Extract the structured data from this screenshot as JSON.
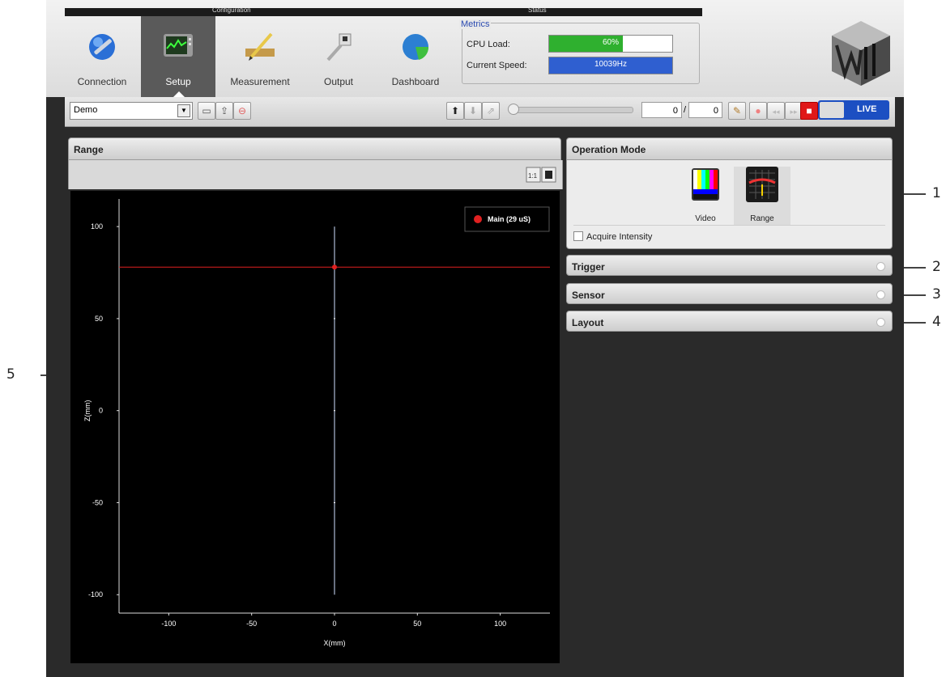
{
  "nav": {
    "group_configuration": "Configuration",
    "group_status": "Status",
    "tabs": [
      {
        "label": "Connection",
        "icon": "wrench-globe-icon"
      },
      {
        "label": "Setup",
        "icon": "monitor-graph-icon",
        "active": true
      },
      {
        "label": "Measurement",
        "icon": "ruler-pencil-icon"
      },
      {
        "label": "Output",
        "icon": "plug-cable-icon"
      },
      {
        "label": "Dashboard",
        "icon": "pie-globe-icon"
      }
    ]
  },
  "metrics": {
    "title": "Metrics",
    "cpu_label": "CPU Load:",
    "cpu_value": "60%",
    "cpu_fraction": 0.6,
    "speed_label": "Current Speed:",
    "speed_value": "10039Hz",
    "speed_fraction": 1.0,
    "cpu_color": "#2fb02f",
    "speed_color": "#2f5fd0"
  },
  "toolbar": {
    "profile": "Demo",
    "frame_current": "0",
    "frame_total": "0",
    "live_label": "LIVE",
    "live_color": "#1c4fc2",
    "stop_color": "#e01818"
  },
  "range_panel": {
    "title": "Range"
  },
  "operation_mode": {
    "title": "Operation Mode",
    "modes": [
      {
        "label": "Video",
        "icon": "color-bars-icon"
      },
      {
        "label": "Range",
        "icon": "range-grid-icon",
        "active": true
      }
    ],
    "acquire_intensity": "Acquire Intensity"
  },
  "sections": [
    {
      "label": "Trigger"
    },
    {
      "label": "Sensor"
    },
    {
      "label": "Layout"
    }
  ],
  "callouts": [
    "1",
    "2",
    "3",
    "4",
    "5"
  ],
  "chart_data": {
    "type": "line",
    "xlabel": "X(mm)",
    "ylabel": "Z(mm)",
    "xlim": [
      -130,
      130
    ],
    "ylim": [
      -110,
      115
    ],
    "xticks": [
      -100,
      -50,
      0,
      50,
      100
    ],
    "yticks": [
      100,
      50,
      0,
      -50,
      -100
    ],
    "legend": "Main (29 uS)",
    "legend_placement": "top-right",
    "series_color": "#e02020",
    "horizontal_line_z": 78,
    "vertical_line": {
      "x": 0,
      "z_from": -100,
      "z_to": 100
    },
    "point": {
      "x": 0,
      "z": 78
    }
  }
}
